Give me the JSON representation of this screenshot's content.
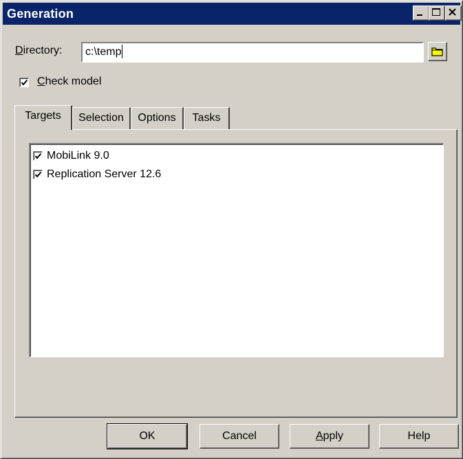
{
  "window": {
    "title": "Generation"
  },
  "directory": {
    "label_accel": "D",
    "label_rest": "irectory:",
    "value": "c:\\temp"
  },
  "check_model": {
    "label_accel": "C",
    "label_rest": "heck model",
    "checked": true
  },
  "tabs": [
    {
      "label": "Targets",
      "active": true
    },
    {
      "label": "Selection",
      "active": false
    },
    {
      "label": "Options",
      "active": false
    },
    {
      "label": "Tasks",
      "active": false
    }
  ],
  "targets": [
    {
      "label": "MobiLink 9.0",
      "checked": true
    },
    {
      "label": "Replication Server 12.6",
      "checked": true
    }
  ],
  "buttons": {
    "ok": "OK",
    "cancel": "Cancel",
    "apply_accel": "A",
    "apply_rest": "pply",
    "help": "Help"
  }
}
